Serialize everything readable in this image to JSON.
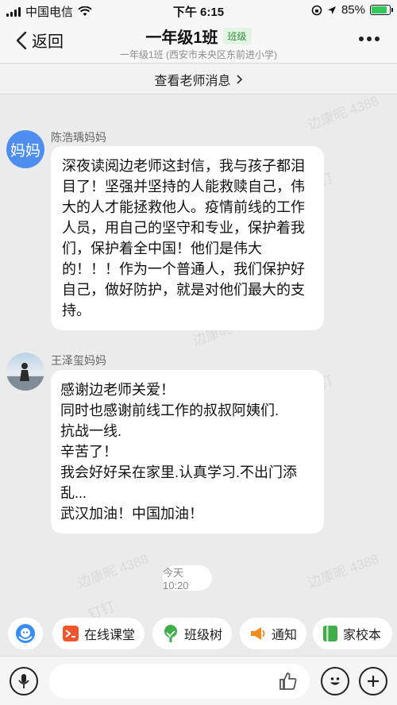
{
  "status_bar": {
    "carrier": "中国电信",
    "time": "下午 6:15",
    "battery_percent": "85%",
    "battery_level": 0.85,
    "icons": [
      "signal-icon",
      "wifi-icon",
      "rotation-lock-icon",
      "location-icon",
      "battery-icon"
    ]
  },
  "nav": {
    "back_label": "返回",
    "title": "一年级1班",
    "badge": "班级",
    "subtitle": "一年级1班 (西安市未央区东前进小学)",
    "more_icon": "more-icon"
  },
  "teacher_banner": {
    "label": "查看老师消息",
    "icon": "chevron-right-icon"
  },
  "watermark": {
    "name": "边康昵",
    "number": "4388",
    "app": "钉钉"
  },
  "messages": [
    {
      "sender": "陈浩瑀妈妈",
      "avatar_text": "妈妈",
      "text": "深夜读阅边老师这封信，我与孩子都泪目了！坚强并坚持的人能救赎自己，伟大的人才能拯救他人。疫情前线的工作人员，用自己的坚守和专业，保护着我们，保护着全中国！他们是伟大的！！！作为一个普通人，我们保护好自己，做好防护，就是对他们最大的支持。"
    },
    {
      "sender": "王泽玺妈妈",
      "avatar_icon": "user-photo-avatar",
      "text": "感谢边老师关爱！\n同时也感谢前线工作的叔叔阿姨们.\n抗战一线.\n辛苦了！\n我会好好呆在家里.认真学习.不出门添乱...\n武汉加油！中国加油！"
    }
  ],
  "timestamp": "今天 10:20",
  "quick_actions": [
    {
      "label": "",
      "icon": "assistant-icon"
    },
    {
      "label": "在线课堂",
      "icon": "online-class-icon",
      "color": "#f0562d"
    },
    {
      "label": "班级树",
      "icon": "class-tree-icon",
      "color": "#3fae49"
    },
    {
      "label": "通知",
      "icon": "megaphone-icon",
      "color": "#f28a1e"
    },
    {
      "label": "家校本",
      "icon": "homework-book-icon",
      "color": "#3fae49"
    }
  ],
  "input_bar": {
    "placeholder": "",
    "icons": [
      "microphone-icon",
      "thumbs-up-icon",
      "emoji-icon",
      "plus-icon"
    ]
  },
  "colors": {
    "accent_blue": "#4e8ef1",
    "badge_green": "#2f8f3a",
    "background": "#ebebeb"
  }
}
